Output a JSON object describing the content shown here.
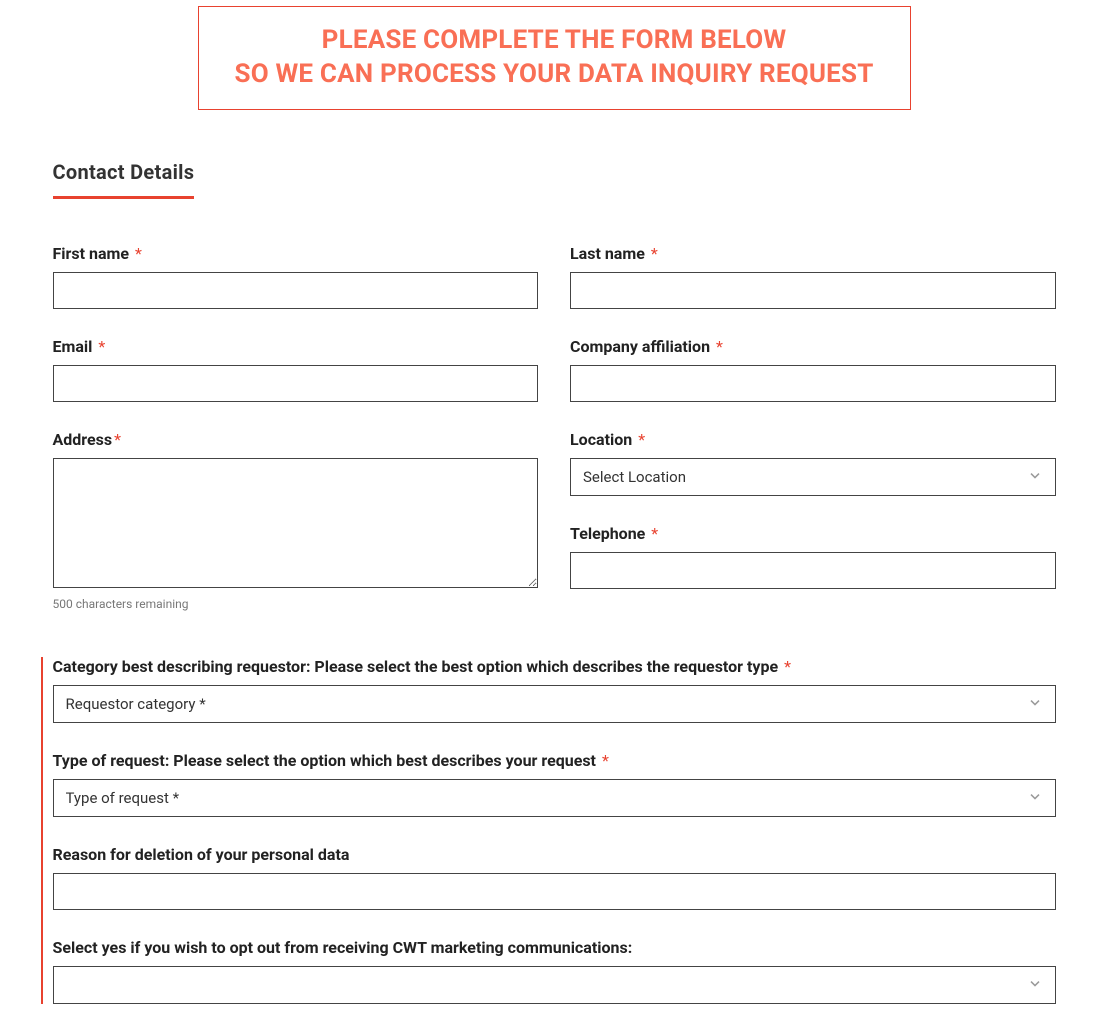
{
  "header": {
    "line1": "PLEASE COMPLETE THE FORM BELOW",
    "line2": "SO WE CAN PROCESS YOUR DATA INQUIRY REQUEST"
  },
  "section_title": "Contact Details",
  "required_mark": "*",
  "fields": {
    "first_name": {
      "label": "First name",
      "value": ""
    },
    "last_name": {
      "label": "Last name",
      "value": ""
    },
    "email": {
      "label": "Email",
      "value": ""
    },
    "company": {
      "label": "Company affiliation",
      "value": ""
    },
    "address": {
      "label": "Address",
      "value": "",
      "hint": "500 characters remaining"
    },
    "location": {
      "label": "Location",
      "selected": "Select Location"
    },
    "telephone": {
      "label": "Telephone",
      "value": ""
    },
    "category": {
      "label": "Category best describing requestor: Please select the best option which describes the requestor type",
      "selected": "Requestor category *"
    },
    "request_type": {
      "label": "Type of request: Please select the option which best describes your request",
      "selected": "Type of request *"
    },
    "deletion_reason": {
      "label": "Reason for deletion of your personal data",
      "value": ""
    },
    "opt_out": {
      "label": "Select yes if you wish to opt out from receiving CWT marketing communications:",
      "selected": ""
    }
  }
}
